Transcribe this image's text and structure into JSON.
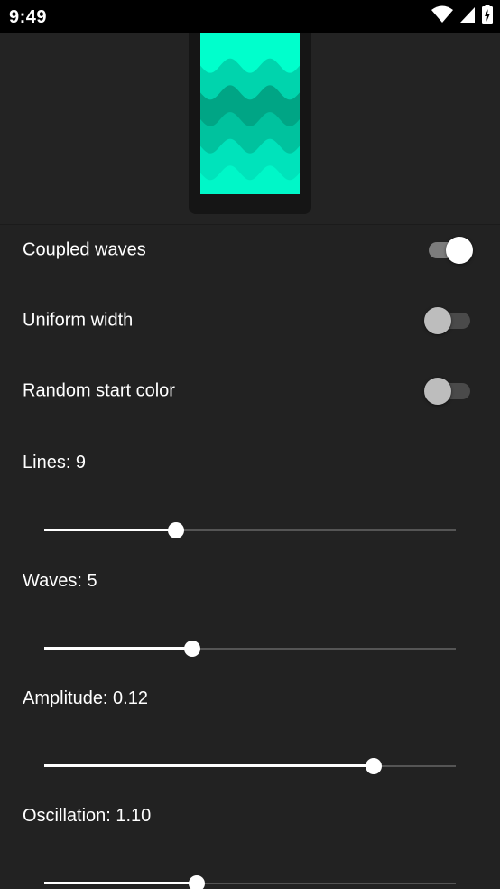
{
  "status_bar": {
    "time": "9:49",
    "icons": [
      "wifi-icon",
      "cell-signal-icon",
      "battery-charging-icon"
    ]
  },
  "preview": {
    "wave_colors": [
      "#00ffcc",
      "#00d4ad",
      "#00a585",
      "#00c29e",
      "#00e3bb",
      "#00f7c8"
    ]
  },
  "settings": {
    "toggles": [
      {
        "label": "Coupled waves",
        "on": true
      },
      {
        "label": "Uniform width",
        "on": false
      },
      {
        "label": "Random start color",
        "on": false
      }
    ],
    "sliders": [
      {
        "label": "Lines: 9",
        "fraction": 0.32
      },
      {
        "label": "Waves: 5",
        "fraction": 0.36
      },
      {
        "label": "Amplitude: 0.12",
        "fraction": 0.8
      },
      {
        "label": "Oscillation: 1.10",
        "fraction": 0.37
      }
    ]
  },
  "colors": {
    "background": "#222222",
    "accent_teal": "#00ffcc",
    "switch_track_on": "#7c7c7c",
    "switch_track_off": "#4a4a4a"
  }
}
